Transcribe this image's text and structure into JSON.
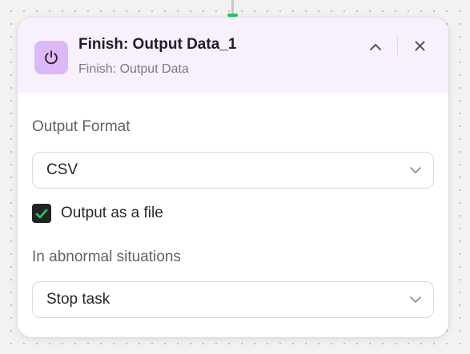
{
  "node": {
    "title": "Finish: Output Data_1",
    "subtitle": "Finish: Output Data",
    "icon": "power-icon",
    "accent_color": "#dcb8f7",
    "header_background": "#f8f0fd"
  },
  "header_actions": {
    "collapse_icon": "chevron-up-icon",
    "close_icon": "close-icon"
  },
  "output_format": {
    "label": "Output Format",
    "value": "CSV"
  },
  "output_as_file": {
    "label": "Output as a file",
    "checked": true,
    "check_color": "#22c55e"
  },
  "abnormal": {
    "label": "In abnormal situations",
    "value": "Stop task"
  }
}
